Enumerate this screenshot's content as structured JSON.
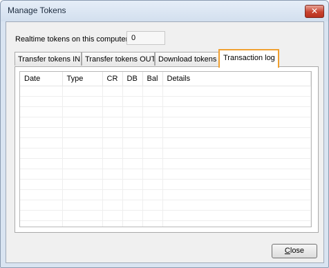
{
  "window": {
    "title": "Manage Tokens",
    "close_glyph": "✕"
  },
  "realtime": {
    "label": "Realtime tokens on this computer:",
    "value": "0"
  },
  "tabs": [
    {
      "label": "Transfer tokens IN"
    },
    {
      "label": "Transfer tokens OUT"
    },
    {
      "label": "Download tokens"
    },
    {
      "label": "Transaction log",
      "active": true
    }
  ],
  "table": {
    "columns": [
      "Date",
      "Type",
      "CR",
      "DB",
      "Bal",
      "Details"
    ],
    "rows": []
  },
  "buttons": {
    "close": "Close"
  },
  "colors": {
    "active_tab_border": "#f0a030",
    "close_button": "#c8422f"
  }
}
